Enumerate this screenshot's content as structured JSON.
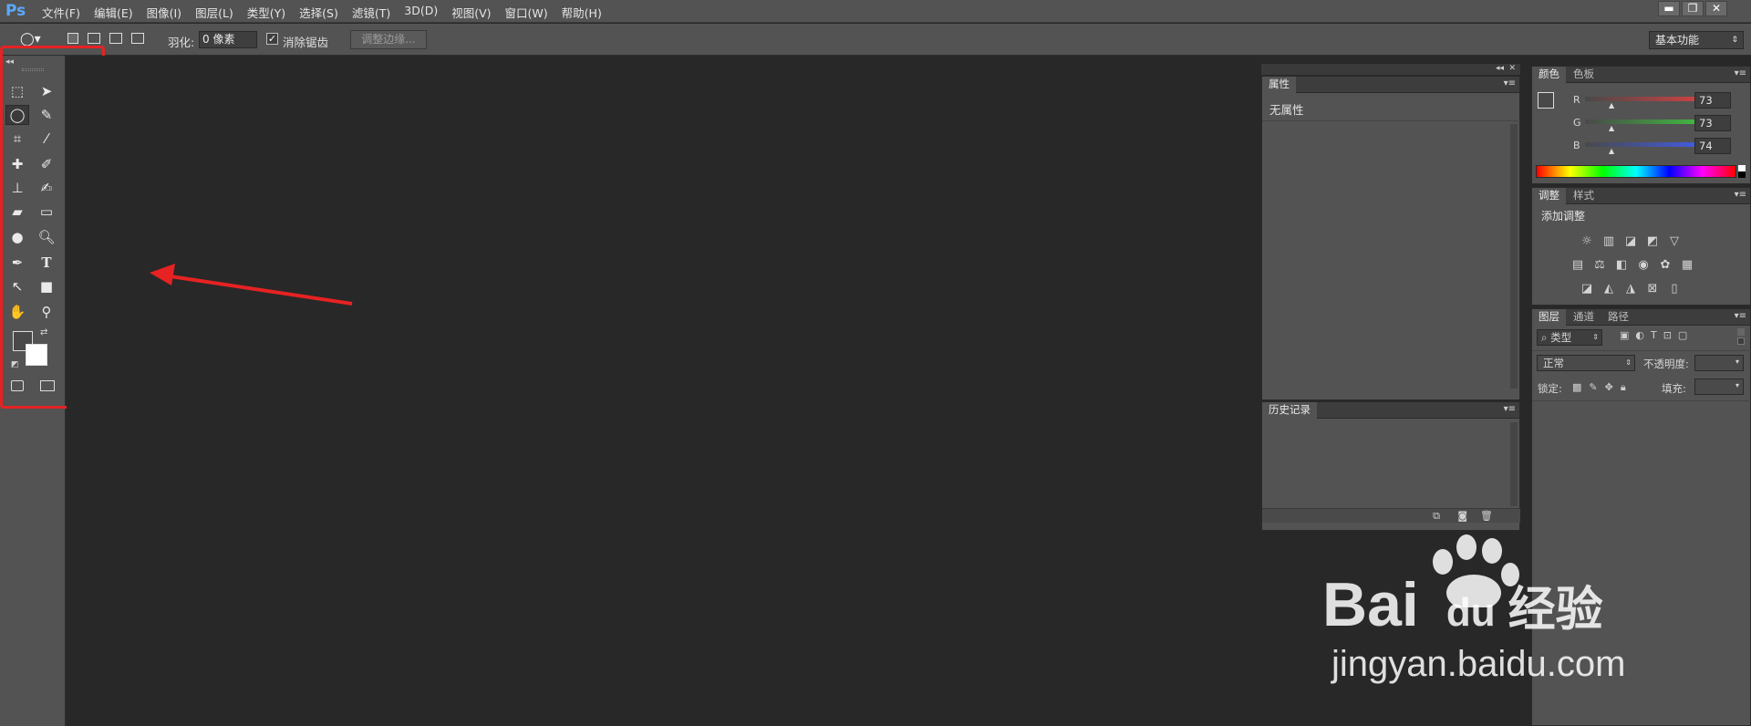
{
  "app": {
    "logo": "Ps"
  },
  "menu": [
    "文件(F)",
    "编辑(E)",
    "图像(I)",
    "图层(L)",
    "类型(Y)",
    "选择(S)",
    "滤镜(T)",
    "3D(D)",
    "视图(V)",
    "窗口(W)",
    "帮助(H)"
  ],
  "window_controls": {
    "minimize": "▬",
    "restore": "❐",
    "close": "✕"
  },
  "options": {
    "feather_label": "羽化:",
    "feather_value": "0 像素",
    "antialias_label": "消除锯齿",
    "refine_edge": "调整边缘...",
    "workspace": "基本功能"
  },
  "properties_panel": {
    "tab": "属性",
    "content": "无属性"
  },
  "history_panel": {
    "tab": "历史记录"
  },
  "color_panel": {
    "tabs": [
      "颜色",
      "色板"
    ],
    "channels": [
      {
        "name": "R",
        "value": "73",
        "color": "#e84040"
      },
      {
        "name": "G",
        "value": "73",
        "color": "#3fcf3f"
      },
      {
        "name": "B",
        "value": "74",
        "color": "#4060ff"
      }
    ]
  },
  "adjust_panel": {
    "tabs": [
      "调整",
      "样式"
    ],
    "title": "添加调整"
  },
  "layers_panel": {
    "tabs": [
      "图层",
      "通道",
      "路径"
    ],
    "filter": "类型",
    "blend_mode": "正常",
    "opacity_label": "不透明度:",
    "lock_label": "锁定:",
    "fill_label": "填充:"
  },
  "watermark": {
    "brand1": "Bai",
    "brand2": "du",
    "brand3": "经验",
    "url": "jingyan.baidu.com"
  },
  "colors": {
    "annotation_red": "#e62222",
    "ps_blue": "#5aa9ff"
  }
}
